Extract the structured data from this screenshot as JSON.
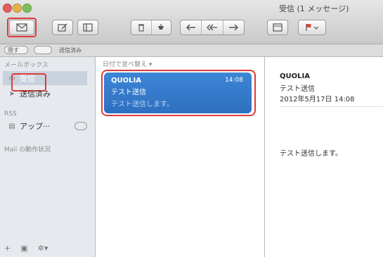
{
  "window": {
    "title": "受信 (1 メッセージ)"
  },
  "toolbar": {
    "get_mail_icon": "envelope-icon",
    "compose_icon": "compose-icon",
    "hide_icon": "sidebar-icon",
    "delete_icon": "trash-icon",
    "junk_icon": "junk-icon",
    "reply_icon": "reply-icon",
    "reply_all_icon": "reply-all-icon",
    "forward_icon": "forward-icon",
    "note_icon": "note-icon",
    "flag_icon": "flag-icon",
    "highlight_color": "#e03a3a"
  },
  "favorites": {
    "hide": "隠す",
    "sent": "送信済み"
  },
  "sidebar": {
    "header_mailboxes": "メールボックス",
    "inbox": "受信",
    "sent": "送信済み",
    "header_rss": "RSS",
    "rss_item": "アップ···",
    "activity": "Mail の動作状況"
  },
  "list": {
    "sort_label": "日付で並べ替え",
    "message": {
      "from": "QUOLIA",
      "time": "14:08",
      "subject": "テスト送信",
      "preview": "テスト送信します。"
    },
    "selected_color": "#3a7fd0"
  },
  "preview": {
    "from": "QUOLIA",
    "subject": "テスト送信",
    "date": "2012年5月17日 14:08",
    "body": "テスト送信します。"
  }
}
